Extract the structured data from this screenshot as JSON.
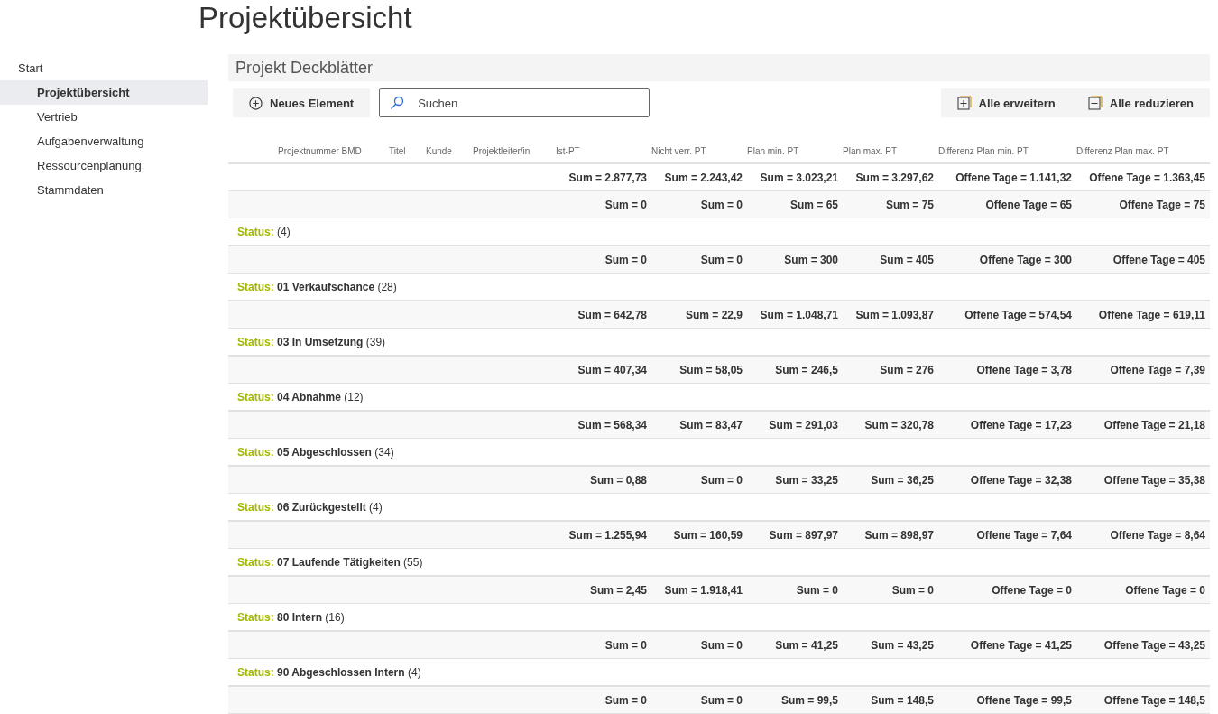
{
  "page_title": "Projektübersicht",
  "nav": [
    {
      "label": "Start",
      "selected": false,
      "children": [
        {
          "label": "Projektübersicht",
          "selected": true
        },
        {
          "label": "Vertrieb",
          "selected": false
        },
        {
          "label": "Aufgabenverwaltung",
          "selected": false
        },
        {
          "label": "Ressourcenplanung",
          "selected": false
        },
        {
          "label": "Stammdaten",
          "selected": false
        }
      ]
    }
  ],
  "list_title": "Projekt Deckblätter",
  "toolbar": {
    "new_button": "Neues Element",
    "search": {
      "placeholder": "Suchen"
    },
    "expand_button": "Alle erweitern",
    "collapse_button": "Alle reduzieren"
  },
  "columns": [
    "Projektnummer BMD",
    "Titel",
    "Kunde",
    "Projektleiter/in",
    "Ist-PT",
    "Nicht verr. PT",
    "Plan min. PT",
    "Plan max. PT",
    "Differenz Plan min. PT",
    "Differenz Plan max. PT"
  ],
  "totals": [
    "Sum = 2.877,73",
    "Sum = 2.243,42",
    "Sum = 3.023,21",
    "Sum = 3.297,62",
    "Offene Tage = 1.141,32",
    "Offene Tage = 1.363,45"
  ],
  "rows": [
    {
      "kind": "sums",
      "values": [
        "Sum = 0",
        "Sum = 0",
        "Sum = 65",
        "Sum = 75",
        "Offene Tage = 65",
        "Offene Tage = 75"
      ]
    },
    {
      "kind": "group",
      "label": "Status:",
      "text": "(4)"
    },
    {
      "kind": "sums",
      "values": [
        "Sum = 0",
        "Sum = 0",
        "Sum = 300",
        "Sum = 405",
        "Offene Tage = 300",
        "Offene Tage = 405"
      ]
    },
    {
      "kind": "group",
      "label": "Status:",
      "text": "**01 Verkaufschance** (28)"
    },
    {
      "kind": "sums",
      "values": [
        "Sum = 642,78",
        "Sum = 22,9",
        "Sum = 1.048,71",
        "Sum = 1.093,87",
        "Offene Tage = 574,54",
        "Offene Tage = 619,11"
      ]
    },
    {
      "kind": "group",
      "label": "Status:",
      "text": "**03 In Umsetzung** (39)"
    },
    {
      "kind": "sums",
      "values": [
        "Sum = 407,34",
        "Sum = 58,05",
        "Sum = 246,5",
        "Sum = 276",
        "Offene Tage = 3,78",
        "Offene Tage = 7,39"
      ]
    },
    {
      "kind": "group",
      "label": "Status:",
      "text": "**04 Abnahme** (12)"
    },
    {
      "kind": "sums",
      "values": [
        "Sum = 568,34",
        "Sum = 83,47",
        "Sum = 291,03",
        "Sum = 320,78",
        "Offene Tage = 17,23",
        "Offene Tage = 21,18"
      ]
    },
    {
      "kind": "group",
      "label": "Status:",
      "text": "**05 Abgeschlossen** (34)"
    },
    {
      "kind": "sums",
      "values": [
        "Sum = 0,88",
        "Sum = 0",
        "Sum = 33,25",
        "Sum = 36,25",
        "Offene Tage = 32,38",
        "Offene Tage = 35,38"
      ]
    },
    {
      "kind": "group",
      "label": "Status:",
      "text": "**06 Zurückgestellt** (4)"
    },
    {
      "kind": "sums",
      "values": [
        "Sum = 1.255,94",
        "Sum = 160,59",
        "Sum = 897,97",
        "Sum = 898,97",
        "Offene Tage = 7,64",
        "Offene Tage = 8,64"
      ]
    },
    {
      "kind": "group",
      "label": "Status:",
      "text": "**07 Laufende Tätigkeiten** (55)"
    },
    {
      "kind": "sums",
      "values": [
        "Sum = 2,45",
        "Sum = 1.918,41",
        "Sum = 0",
        "Sum = 0",
        "Offene Tage = 0",
        "Offene Tage = 0"
      ]
    },
    {
      "kind": "group",
      "label": "Status:",
      "text": "**80 Intern** (16)"
    },
    {
      "kind": "sums",
      "values": [
        "Sum = 0",
        "Sum = 0",
        "Sum = 41,25",
        "Sum = 43,25",
        "Offene Tage = 41,25",
        "Offene Tage = 43,25"
      ]
    },
    {
      "kind": "group",
      "label": "Status:",
      "text": "**90 Abgeschlossen Intern** (4)"
    },
    {
      "kind": "sums",
      "values": [
        "Sum = 0",
        "Sum = 0",
        "Sum = 99,5",
        "Sum = 148,5",
        "Offene Tage = 99,5",
        "Offene Tage = 148,5"
      ]
    }
  ]
}
